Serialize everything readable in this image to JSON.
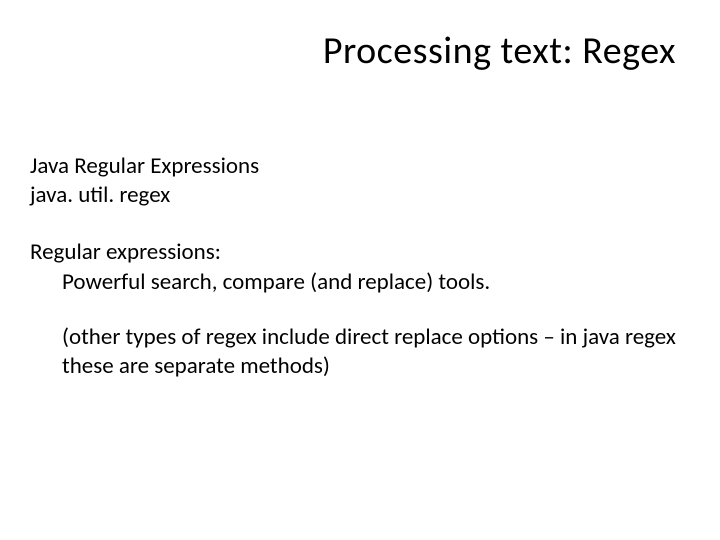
{
  "title": "Processing text: Regex",
  "section1": {
    "line1": "Java Regular Expressions",
    "line2": "java. util. regex"
  },
  "section2": {
    "heading": "Regular expressions:",
    "line1": "Powerful search, compare (and replace) tools.",
    "line2": "(other types of regex include direct replace options – in java regex these are separate methods)"
  }
}
